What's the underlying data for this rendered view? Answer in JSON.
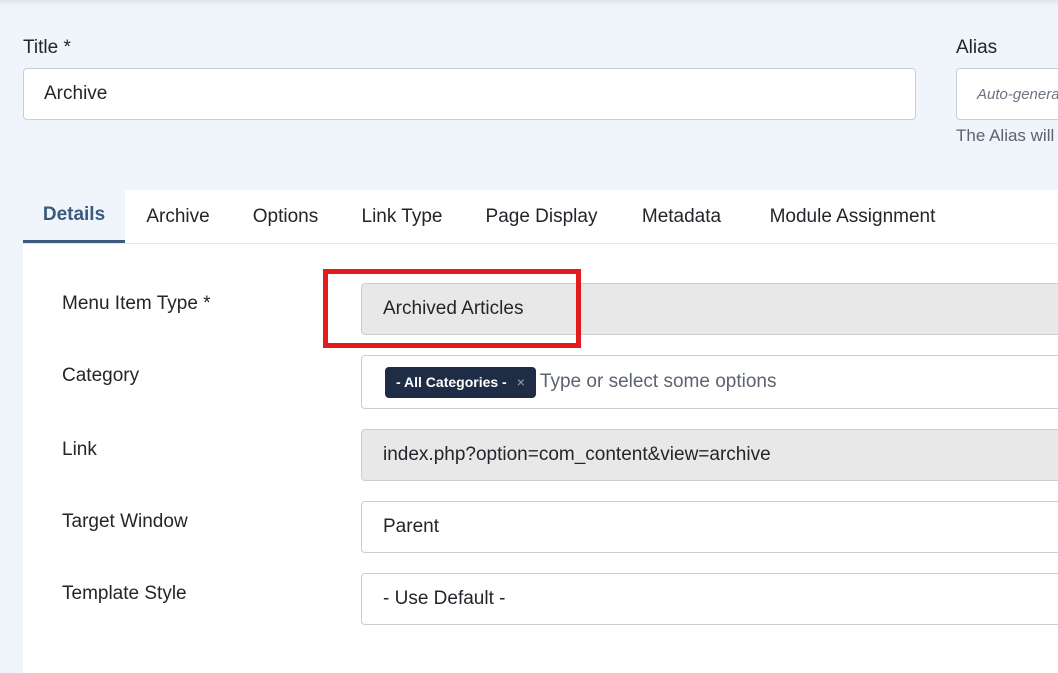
{
  "header": {
    "title_label": "Title *",
    "title_value": "Archive",
    "alias_label": "Alias",
    "alias_placeholder": "Auto-genera",
    "alias_help": "The Alias will"
  },
  "tabs": [
    {
      "label": "Details",
      "active": true
    },
    {
      "label": "Archive",
      "active": false
    },
    {
      "label": "Options",
      "active": false
    },
    {
      "label": "Link Type",
      "active": false
    },
    {
      "label": "Page Display",
      "active": false
    },
    {
      "label": "Metadata",
      "active": false
    },
    {
      "label": "Module Assignment",
      "active": false
    }
  ],
  "form": {
    "menu_item_type_label": "Menu Item Type *",
    "menu_item_type_value": "Archived Articles",
    "category_label": "Category",
    "category_chip": "- All Categories -",
    "category_chip_remove": "×",
    "category_placeholder": "Type or select some options",
    "link_label": "Link",
    "link_value": "index.php?option=com_content&view=archive",
    "target_window_label": "Target Window",
    "target_window_value": "Parent",
    "template_style_label": "Template Style",
    "template_style_value": "- Use Default -"
  },
  "colors": {
    "background": "#f0f4fb",
    "accent": "#3b5a7f",
    "chip": "#1e2d45",
    "highlight": "#e41b1b"
  }
}
